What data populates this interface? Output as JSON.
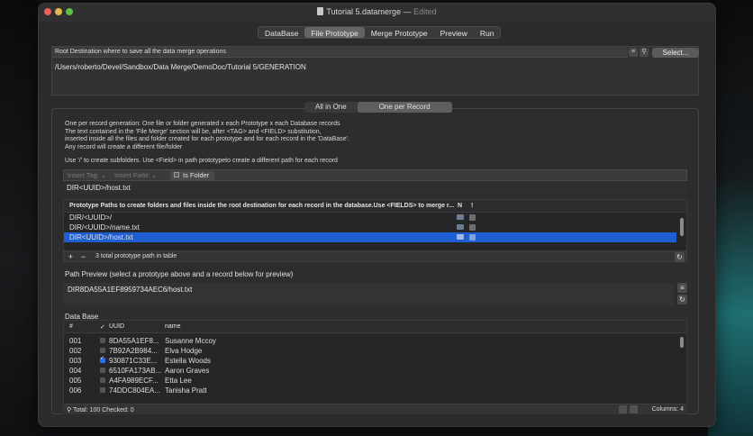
{
  "window": {
    "title": "Tutorial 5.datamerge",
    "status": "Edited"
  },
  "toolbar": {
    "tabs": [
      "DataBase",
      "File Prototype",
      "Merge Prototype",
      "Preview",
      "Run"
    ],
    "active_tab": "File Prototype"
  },
  "root": {
    "label": "Root Destination where to save all the data merge operations",
    "select_label": "Select...",
    "path": "/Users/roberto/Devel/Sandbox/Data Merge/DemoDoc/Tutorial 5/GENERATION"
  },
  "mode": {
    "options": [
      "All in One",
      "One per Record"
    ],
    "active": "One per Record"
  },
  "description": {
    "lines": [
      "One per record generation: One file or folder  generated x each Prototype x each Database records",
      "The text contained in the 'File Merge' section will be, after <TAG> and <FIELD> substitution,",
      "inserted inside all the files and folder created for each prototype and for each record in the 'DataBase'.",
      "Any record will create a different file/folder"
    ],
    "hint": "Use '/' to create subfolders.  Use <Field> in path prototypeto create a different path for each record"
  },
  "tag_bar": {
    "insert_tag": "Insert Tag:",
    "insert_field": "Insert Field:",
    "is_folder": "Is Folder"
  },
  "current_path": "DIR<UUID>/host.txt",
  "paths_table": {
    "header": "Prototype Paths to create folders and  files inside the root destination for each record in the database.Use <FIELDS> to merge r...",
    "col_n": "N",
    "col_excl": "!",
    "rows": [
      "DIR/<UUID>/",
      "DIR/<UUID>/name.txt",
      "DIR<UUID>/host.txt"
    ],
    "selected_index": 2,
    "footer_count": "3 total prototype path in table"
  },
  "preview": {
    "title": "Path Preview (select a prototype above and a record below for preview)",
    "value": "DIR8DA55A1EF8959734AEC6/host.txt"
  },
  "database": {
    "title": "Data Base",
    "columns": [
      "#",
      "✓",
      "UUID",
      "name"
    ],
    "rows": [
      {
        "n": "001",
        "checked": false,
        "uuid": "8DA55A1EF8...",
        "name": "Susanne Mccoy"
      },
      {
        "n": "002",
        "checked": false,
        "uuid": "7B92A2B984...",
        "name": "Elva Hodge"
      },
      {
        "n": "003",
        "checked": true,
        "uuid": "930871C33E...",
        "name": "Estella Woods"
      },
      {
        "n": "004",
        "checked": false,
        "uuid": "6510FA173AB...",
        "name": "Aaron Graves"
      },
      {
        "n": "005",
        "checked": false,
        "uuid": "A4FA989ECF...",
        "name": "Etta Lee"
      },
      {
        "n": "006",
        "checked": false,
        "uuid": "74DDC804EA...",
        "name": "Tanisha Pratt"
      }
    ],
    "footer_left": "Total: 100   Checked: 0",
    "footer_right": "Columns: 4"
  },
  "colors": {
    "selection": "#1f5ed1",
    "window_bg": "#2b2b2d"
  }
}
